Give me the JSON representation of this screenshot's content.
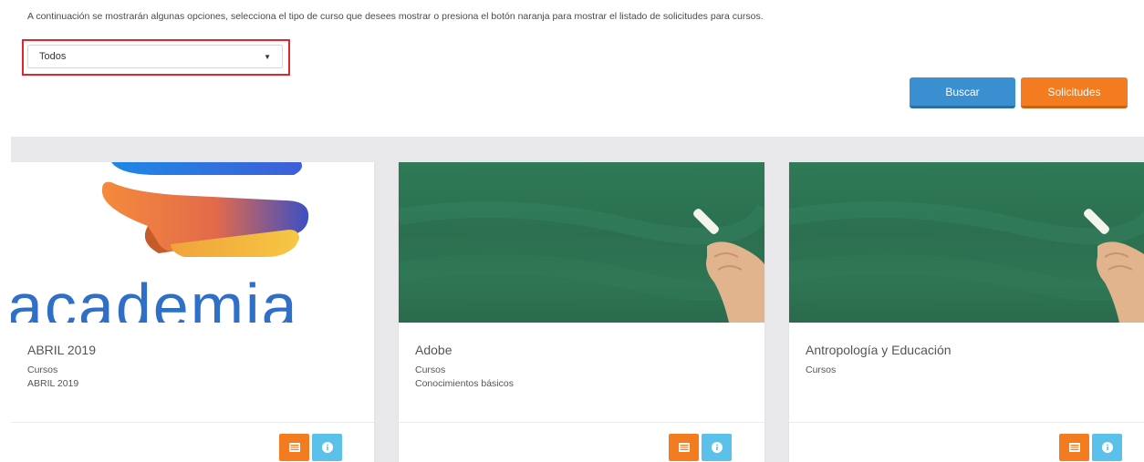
{
  "intro": {
    "text": "A continuación se mostrarán algunas opciones, selecciona el tipo de curso que desees mostrar o presiona el botón naranja para mostrar el listado de solicitudes para cursos."
  },
  "filter": {
    "selected": "Todos"
  },
  "actions": {
    "buscar_label": "Buscar",
    "solicitudes_label": "Solicitudes"
  },
  "cards": [
    {
      "title": "ABRIL 2019",
      "line1": "Cursos",
      "line2": "ABRIL 2019",
      "image": "academia-logo",
      "logo_text": "academia"
    },
    {
      "title": "Adobe",
      "line1": "Cursos",
      "line2": "Conocimientos básicos",
      "image": "chalkboard-hand"
    },
    {
      "title": "Antropología y Educación",
      "line1": "Cursos",
      "line2": "",
      "image": "chalkboard-hand"
    }
  ],
  "icons": {
    "list": "list-icon",
    "info": "info-icon"
  },
  "colors": {
    "primary_blue": "#3a8fd0",
    "accent_orange": "#f47c20",
    "info_blue": "#5bc0ea",
    "highlight_red": "#e0262b"
  }
}
